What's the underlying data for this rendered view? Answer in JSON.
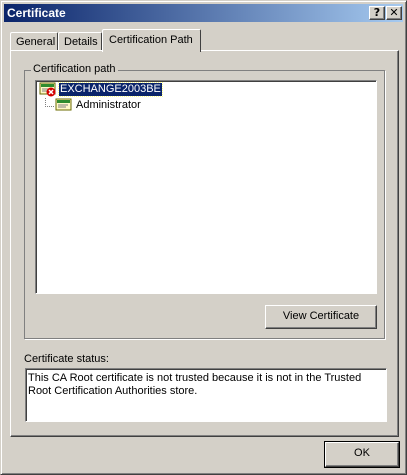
{
  "window": {
    "title": "Certificate",
    "help_glyph": "?",
    "close_glyph": "✕"
  },
  "tabs": [
    {
      "label": "General"
    },
    {
      "label": "Details"
    },
    {
      "label": "Certification Path"
    }
  ],
  "active_tab": "Certification Path",
  "path_group": {
    "label": "Certification path",
    "items": [
      {
        "label": "EXCHANGE2003BE",
        "icon": "certificate-error-icon",
        "selected": true
      },
      {
        "label": "Administrator",
        "icon": "certificate-icon",
        "selected": false
      }
    ]
  },
  "view_certificate_button": "View Certificate",
  "status": {
    "label": "Certificate status:",
    "text": "This CA Root certificate is not trusted because it is not in the Trusted Root Certification Authorities store."
  },
  "ok_button": "OK",
  "colors": {
    "title_gradient_start": "#0a246a",
    "title_gradient_end": "#a6caf0",
    "face": "#d4d0c8",
    "selection": "#0a246a",
    "error_red": "#d40000"
  }
}
